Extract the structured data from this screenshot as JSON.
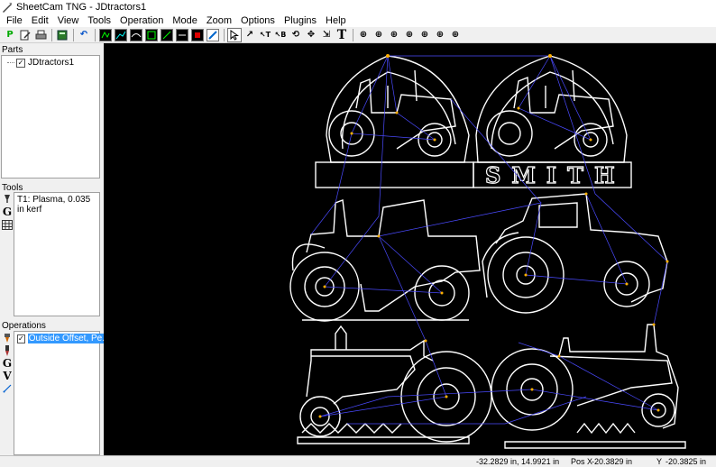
{
  "window": {
    "title": "SheetCam TNG - JDtractors1"
  },
  "menu": [
    "File",
    "Edit",
    "View",
    "Tools",
    "Operation",
    "Mode",
    "Zoom",
    "Options",
    "Plugins",
    "Help"
  ],
  "toolbar_icons": [
    "post-process-icon",
    "edit-icon",
    "print-icon",
    "calculator-icon",
    "undo-icon",
    "view-parts-icon",
    "view-toolpath-icon",
    "view-profile-icon",
    "view-fit-icon",
    "view-rapids-icon",
    "view-cut-icon",
    "view-stop-icon",
    "view-edit-icon",
    "select-tool-icon",
    "move-tool-icon",
    "node-tool-icon",
    "text-node-icon",
    "rotate-tool-icon",
    "align-tool-icon",
    "scale-tool-icon",
    "text-tool-icon",
    "start-point-1-icon",
    "start-point-2-icon",
    "start-point-3-icon",
    "start-point-4-icon",
    "start-point-5-icon",
    "start-point-6-icon",
    "start-point-7-icon"
  ],
  "parts": {
    "label": "Parts",
    "items": [
      {
        "name": "JDtractors1",
        "checked": true
      }
    ]
  },
  "tools": {
    "label": "Tools",
    "items": [
      {
        "name": "T1: Plasma, 0.035 in kerf"
      }
    ]
  },
  "operations": {
    "label": "Operations",
    "items": [
      {
        "name": "Outside Offset, Pe...",
        "checked": true
      }
    ]
  },
  "canvas": {
    "sign_text": "SMITH"
  },
  "status": {
    "coords": "-32.2829 in, 14.9921 in",
    "pos_x_label": "Pos X",
    "pos_x": "-20.3829 in",
    "y_label": "Y",
    "y": "-20.3825 in"
  },
  "colors": {
    "canvas_bg": "#000000",
    "outline": "#ffffff",
    "rapid": "#4a4aff",
    "label": "#ffb000",
    "selection": "#3399ff"
  }
}
